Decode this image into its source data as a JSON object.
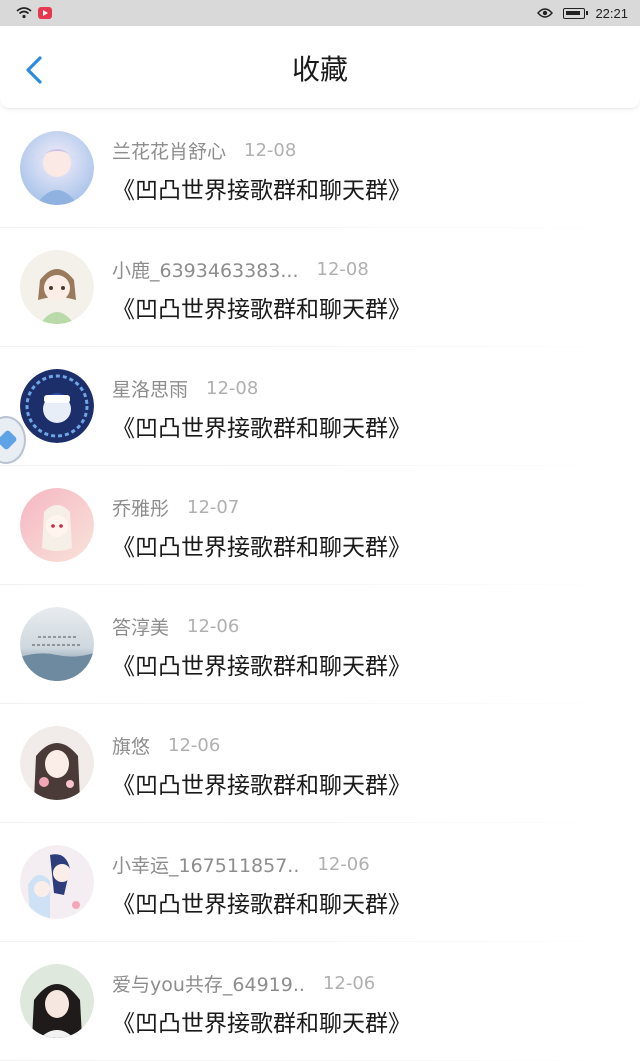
{
  "status_bar": {
    "time": "22:21"
  },
  "header": {
    "title": "收藏"
  },
  "items": [
    {
      "name": "兰花花肖舒心",
      "date": "12-08",
      "message": "《凹凸世界接歌群和聊天群》"
    },
    {
      "name": "小鹿_6393463383...",
      "date": "12-08",
      "message": "《凹凸世界接歌群和聊天群》"
    },
    {
      "name": "星洛思雨",
      "date": "12-08",
      "message": "《凹凸世界接歌群和聊天群》"
    },
    {
      "name": "乔雅彤",
      "date": "12-07",
      "message": "《凹凸世界接歌群和聊天群》"
    },
    {
      "name": "答淳美",
      "date": "12-06",
      "message": "《凹凸世界接歌群和聊天群》"
    },
    {
      "name": "旗悠",
      "date": "12-06",
      "message": "《凹凸世界接歌群和聊天群》"
    },
    {
      "name": "小幸运_167511857..",
      "date": "12-06",
      "message": "《凹凸世界接歌群和聊天群》"
    },
    {
      "name": "爱与you共存_64919..",
      "date": "12-06",
      "message": "《凹凸世界接歌群和聊天群》"
    }
  ],
  "colors": {
    "accent": "#2b8ae2",
    "name_text": "#8d8d8d",
    "date_text": "#b0b0b0"
  }
}
